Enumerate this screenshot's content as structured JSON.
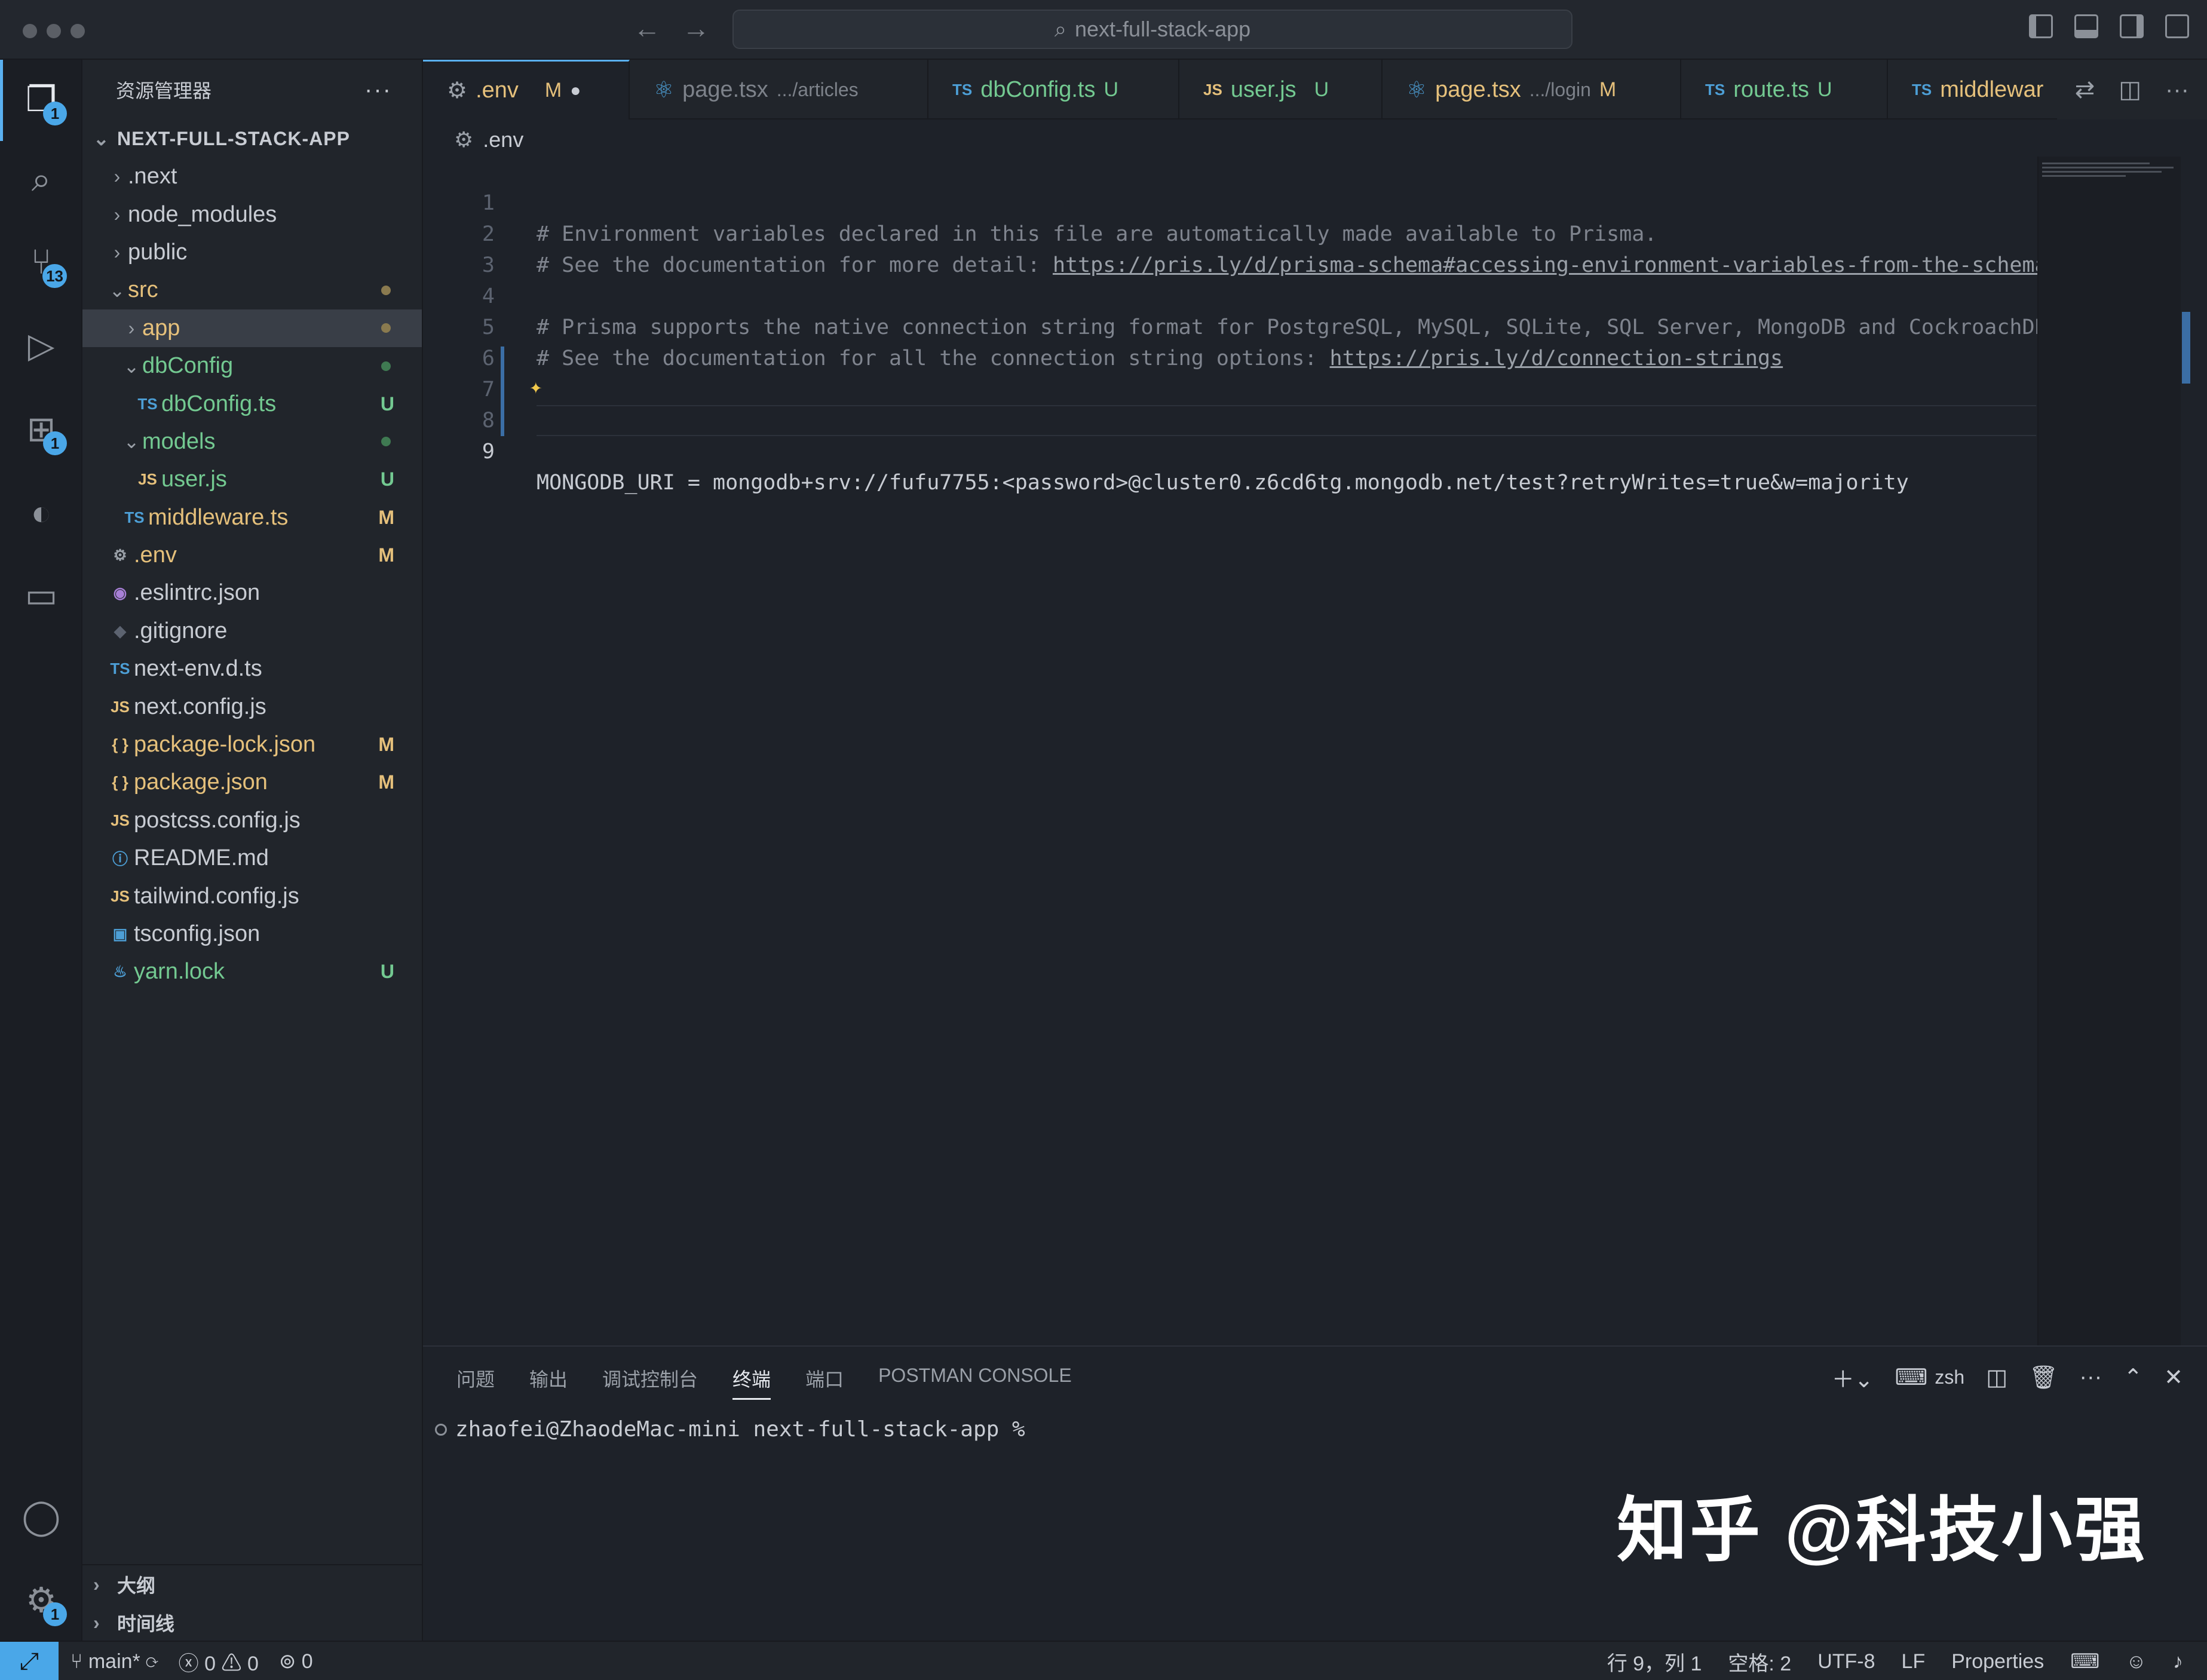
{
  "window": {
    "title": "next-full-stack-app"
  },
  "activity": {
    "explorer_badge": "1",
    "scm_badge": "13",
    "extensions_badge": "1",
    "settings_badge": "1"
  },
  "sidebar": {
    "title": "资源管理器",
    "root": "NEXT-FULL-STACK-APP",
    "items": [
      {
        "name": ".next",
        "status": ""
      },
      {
        "name": "node_modules",
        "status": ""
      },
      {
        "name": "public",
        "status": ""
      },
      {
        "name": "src",
        "status": ""
      },
      {
        "name": "app",
        "status": ""
      },
      {
        "name": "dbConfig",
        "status": ""
      },
      {
        "name": "dbConfig.ts",
        "status": "U",
        "prefix": "TS"
      },
      {
        "name": "models",
        "status": ""
      },
      {
        "name": "user.js",
        "status": "U",
        "prefix": "JS"
      },
      {
        "name": "middleware.ts",
        "status": "M",
        "prefix": "TS"
      },
      {
        "name": ".env",
        "status": "M"
      },
      {
        "name": ".eslintrc.json",
        "status": ""
      },
      {
        "name": ".gitignore",
        "status": ""
      },
      {
        "name": "next-env.d.ts",
        "status": "",
        "prefix": "TS"
      },
      {
        "name": "next.config.js",
        "status": "",
        "prefix": "JS"
      },
      {
        "name": "package-lock.json",
        "status": "M",
        "prefix": "{ }"
      },
      {
        "name": "package.json",
        "status": "M",
        "prefix": "{ }"
      },
      {
        "name": "postcss.config.js",
        "status": "",
        "prefix": "JS"
      },
      {
        "name": "README.md",
        "status": ""
      },
      {
        "name": "tailwind.config.js",
        "status": "",
        "prefix": "JS"
      },
      {
        "name": "tsconfig.json",
        "status": ""
      },
      {
        "name": "yarn.lock",
        "status": "U"
      }
    ],
    "outline": "大纲",
    "timeline": "时间线"
  },
  "tabs": [
    {
      "label": ".env",
      "desc": "",
      "status": "M"
    },
    {
      "label": "page.tsx",
      "desc": ".../articles",
      "status": ""
    },
    {
      "label": "dbConfig.ts",
      "desc": "",
      "status": "U",
      "prefix": "TS"
    },
    {
      "label": "user.js",
      "desc": "",
      "status": "U",
      "prefix": "JS"
    },
    {
      "label": "page.tsx",
      "desc": ".../login",
      "status": "M"
    },
    {
      "label": "route.ts",
      "desc": "",
      "status": "U",
      "prefix": "TS"
    },
    {
      "label": "middlewar",
      "desc": "",
      "status": "",
      "prefix": "TS"
    }
  ],
  "breadcrumb": ".env",
  "editor": {
    "lines": [
      {
        "n": "1",
        "text": "# Environment variables declared in this file are automatically made available to Prisma."
      },
      {
        "n": "2",
        "text": "# See the documentation for more detail: ",
        "link": "https://pris.ly/d/prisma-schema#accessing-environment-variables-from-the-schema"
      },
      {
        "n": "3",
        "text": ""
      },
      {
        "n": "4",
        "text": "# Prisma supports the native connection string format for PostgreSQL, MySQL, SQLite, SQL Server, MongoDB and CockroachDB."
      },
      {
        "n": "5",
        "text": "# See the documentation for all the connection string options: ",
        "link": "https://pris.ly/d/connection-strings"
      },
      {
        "n": "6",
        "text": ""
      },
      {
        "n": "7",
        "text": ""
      },
      {
        "n": "8",
        "text": "MONGODB_URI = mongodb+srv://fufu7755:<password>@cluster0.z6cd6tg.mongodb.net/test?retryWrites=true&w=majority"
      },
      {
        "n": "9",
        "text": ""
      }
    ]
  },
  "panel": {
    "tabs": [
      "问题",
      "输出",
      "调试控制台",
      "终端",
      "端口",
      "POSTMAN CONSOLE"
    ],
    "active_tab": "终端",
    "shell": "zsh",
    "prompt": "zhaofei@ZhaodeMac-mini next-full-stack-app %"
  },
  "watermark": "知乎 @科技小强",
  "statusbar": {
    "branch": "main*",
    "errors": "0",
    "warnings": "0",
    "ports": "0",
    "position": "行 9，列 1",
    "spaces": "空格: 2",
    "encoding": "UTF-8",
    "eol": "LF",
    "language": "Properties"
  },
  "colors": {
    "accent": "#4aa7e8",
    "modified": "#e5c07b",
    "untracked": "#73c991"
  }
}
